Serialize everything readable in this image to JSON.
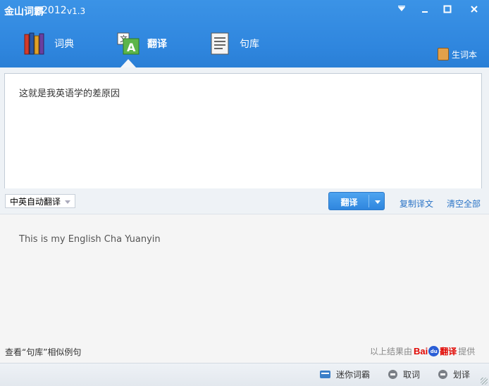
{
  "app": {
    "logo_text": "金山词霸",
    "year": "2012",
    "version": "v1.3"
  },
  "window_controls": {
    "menu": "▼",
    "minimize": "–",
    "maximize": "□",
    "close": "✕"
  },
  "nav": {
    "tabs": [
      {
        "label": "词典",
        "icon": "books-icon"
      },
      {
        "label": "翻译",
        "icon": "translate-icon",
        "active": true
      },
      {
        "label": "句库",
        "icon": "document-icon"
      }
    ],
    "vocab_label": "生词本"
  },
  "input": {
    "text": "这就是我英语学的差原因"
  },
  "controls": {
    "language_mode": "中英自动翻译",
    "translate_label": "翻译",
    "copy_label": "复制译文",
    "clear_label": "清空全部"
  },
  "output": {
    "text": "This is my English Cha Yuanyin",
    "example_link": "查看“句库”相似例句",
    "credit_prefix": "以上结果由",
    "credit_brand_bai": "Bai",
    "credit_brand_du": "du",
    "credit_brand_trans": "翻译",
    "credit_suffix": "提供"
  },
  "footer": {
    "mini_label": "迷你词霸",
    "pick_label": "取词",
    "stroke_label": "划译"
  },
  "colors": {
    "header_blue": "#2f86de",
    "link_blue": "#2b74c6",
    "baidu_red": "#e10601",
    "baidu_blue": "#2a5ed6"
  }
}
